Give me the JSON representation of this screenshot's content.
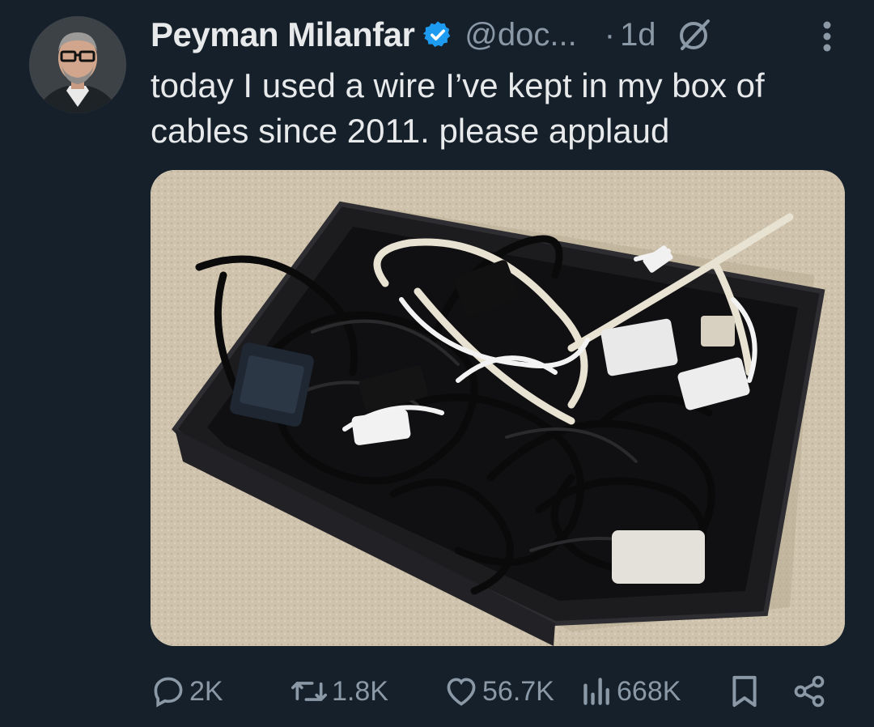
{
  "author": {
    "name": "Peyman Milanfar",
    "handle": "@doc...",
    "time": "1d",
    "separator": "·",
    "verified": true
  },
  "tweet": {
    "text": "today I used a wire I’ve kept in my box of cables since 2011. please applaud",
    "media_description": "photo"
  },
  "stats": {
    "replies": "2K",
    "reposts": "1.8K",
    "likes": "56.7K",
    "views": "668K"
  },
  "icons": {
    "verified": "verified-badge-icon",
    "grok": "grok-icon",
    "more": "more-vertical-icon",
    "reply": "reply-icon",
    "repost": "repost-icon",
    "like": "heart-icon",
    "views": "views-icon",
    "bookmark": "bookmark-icon",
    "share": "share-icon"
  },
  "colors": {
    "background": "#15202b",
    "text": "#e7e9ea",
    "muted": "#8b98a5",
    "verified": "#1d9bf0"
  }
}
